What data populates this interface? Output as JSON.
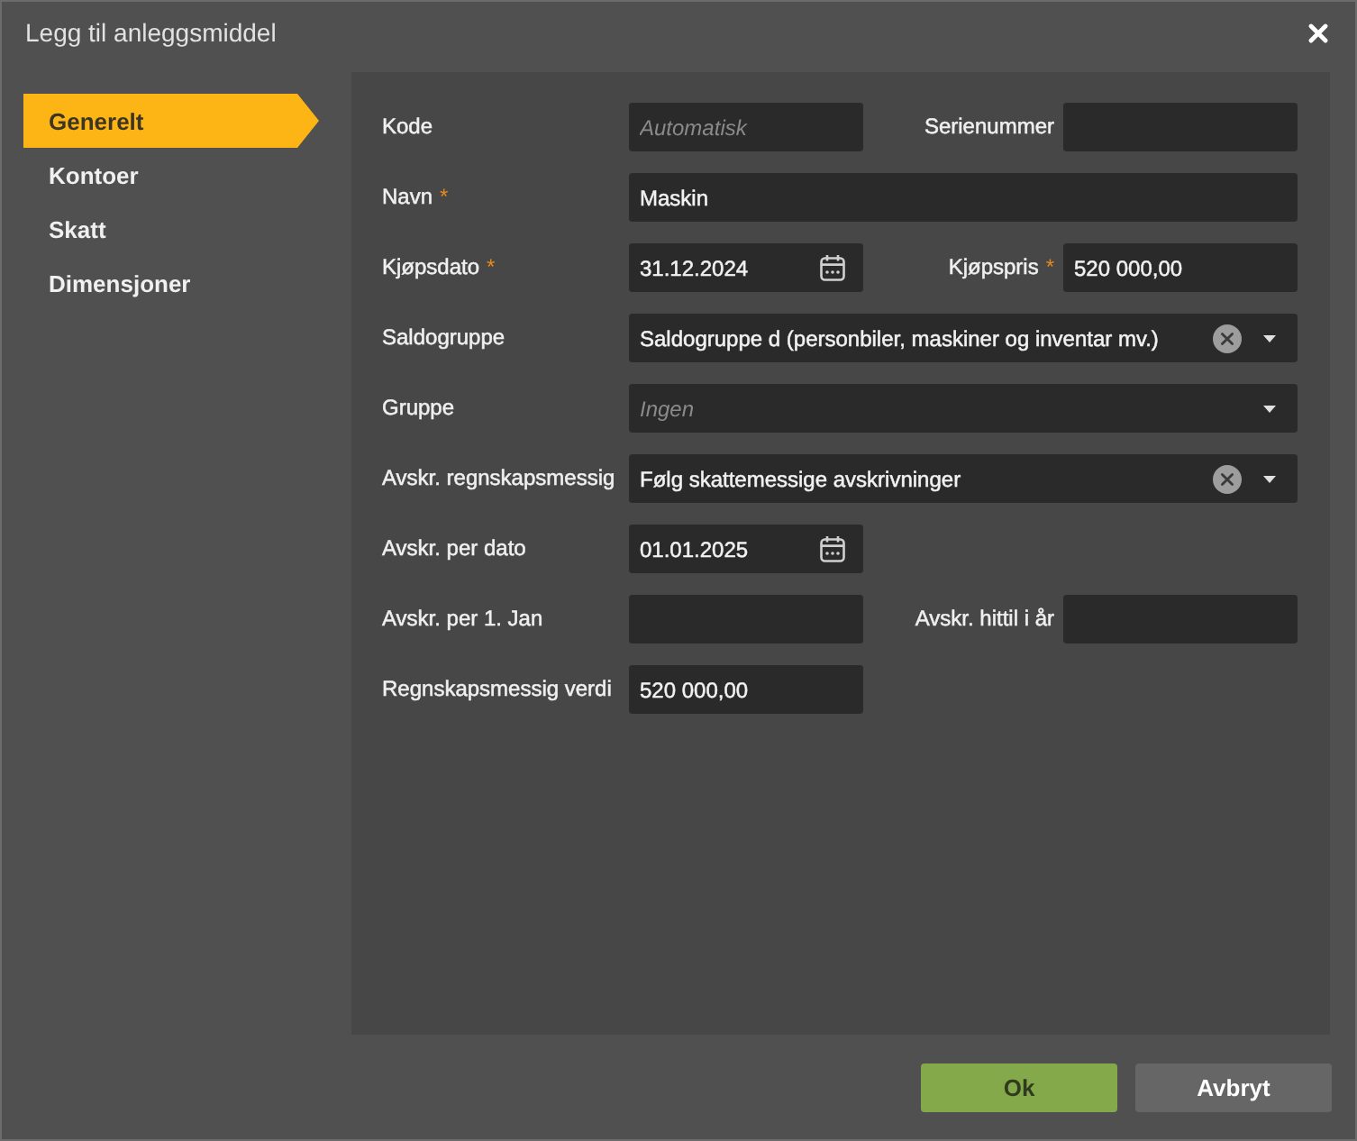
{
  "window": {
    "title": "Legg til anleggsmiddel"
  },
  "sidebar": {
    "items": [
      {
        "label": "Generelt",
        "selected": true
      },
      {
        "label": "Kontoer",
        "selected": false
      },
      {
        "label": "Skatt",
        "selected": false
      },
      {
        "label": "Dimensjoner",
        "selected": false
      }
    ]
  },
  "form": {
    "rows": [
      {
        "fields": [
          {
            "kind": "text",
            "label": "Kode",
            "placeholder": "Automatisk"
          },
          {
            "kind": "text",
            "label": "Serienummer"
          }
        ]
      },
      {
        "fields": [
          {
            "kind": "text",
            "label": "Navn",
            "required_mark": "*",
            "value": "Maskin",
            "wide": true
          }
        ]
      },
      {
        "fields": [
          {
            "kind": "date",
            "label": "Kjøpsdato",
            "required_mark": "*",
            "value": "31.12.2024"
          },
          {
            "kind": "text",
            "label": "Kjøpspris",
            "required_mark": "*",
            "value": "520 000,00"
          }
        ]
      },
      {
        "fields": [
          {
            "kind": "select",
            "label": "Saldogruppe",
            "value": "Saldogruppe d (personbiler, maskiner og inventar mv.)",
            "clearable": true
          }
        ]
      },
      {
        "fields": [
          {
            "kind": "select",
            "label": "Gruppe",
            "placeholder": "Ingen",
            "clearable": false
          }
        ]
      },
      {
        "fields": [
          {
            "kind": "select",
            "label": "Avskr. regnskapsmessig",
            "value": "Følg skattemessige avskrivninger",
            "clearable": true
          }
        ]
      },
      {
        "fields": [
          {
            "kind": "date",
            "label": "Avskr. per dato",
            "value": "01.01.2025"
          }
        ]
      },
      {
        "fields": [
          {
            "kind": "text",
            "label": "Avskr. per 1. Jan"
          },
          {
            "kind": "text",
            "label": "Avskr. hittil i år"
          }
        ]
      },
      {
        "fields": [
          {
            "kind": "text",
            "label": "Regnskapsmessig verdi",
            "value": "520 000,00"
          }
        ]
      }
    ]
  },
  "buttons": [
    {
      "label": "Ok",
      "kind": "primary"
    },
    {
      "label": "Avbryt",
      "kind": "secondary"
    }
  ]
}
